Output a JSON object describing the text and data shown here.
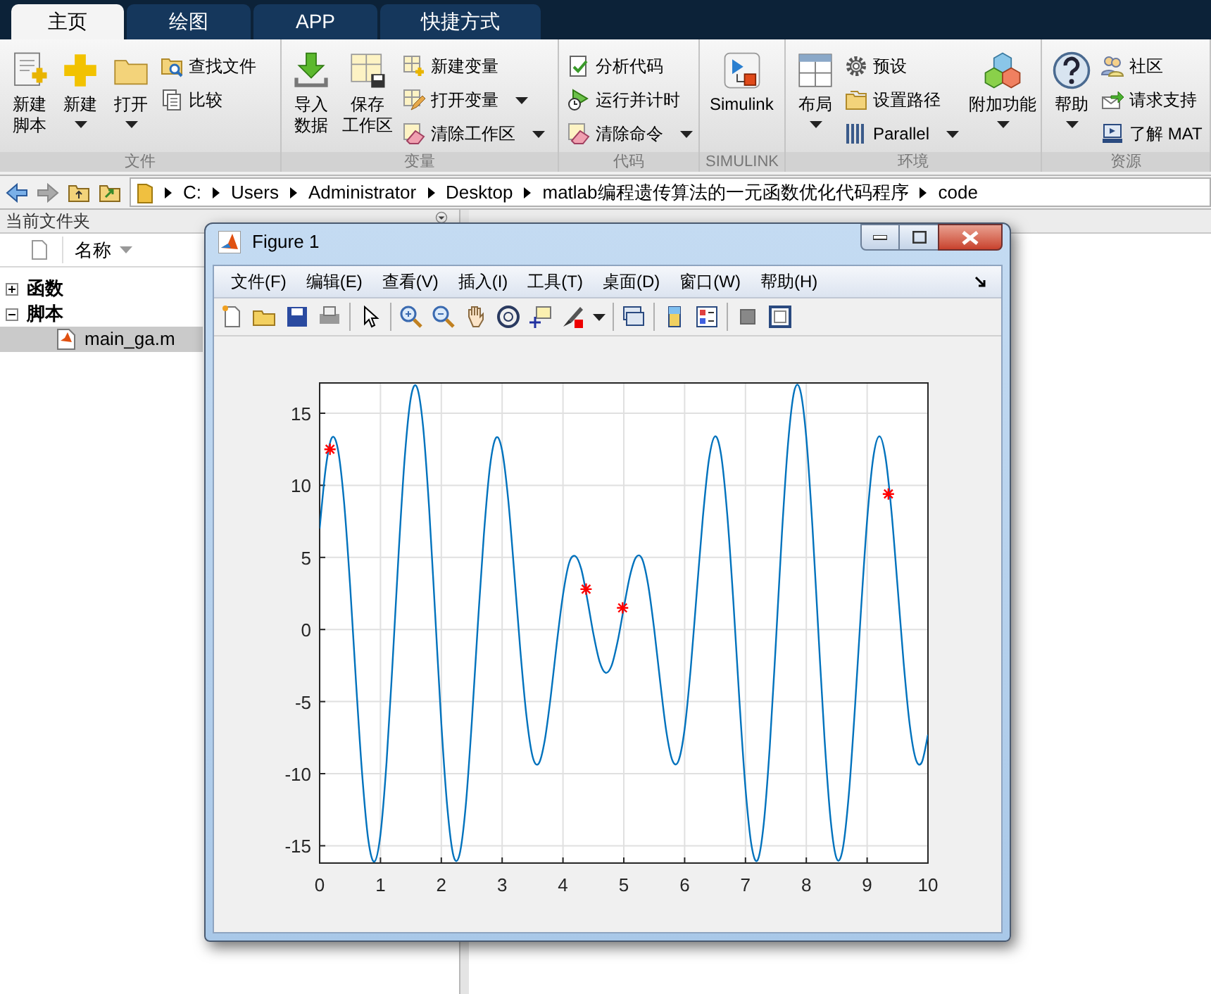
{
  "tabs": [
    {
      "label": "主页",
      "selected": true
    },
    {
      "label": "绘图",
      "selected": false
    },
    {
      "label": "APP",
      "selected": false
    },
    {
      "label": "快捷方式",
      "selected": false
    }
  ],
  "ribbon": {
    "groups": [
      {
        "label": "文件",
        "items": [
          {
            "kind": "large",
            "lines": [
              "新建",
              "脚本"
            ],
            "dropdown": false
          },
          {
            "kind": "large",
            "lines": [
              "新建"
            ],
            "dropdown": true
          },
          {
            "kind": "large",
            "lines": [
              "打开"
            ],
            "dropdown": true
          },
          {
            "kind": "small",
            "lines": [
              "查找文件"
            ],
            "dropdown": false
          },
          {
            "kind": "small",
            "lines": [
              "比较"
            ],
            "dropdown": false
          }
        ]
      },
      {
        "label": "变量",
        "items": [
          {
            "kind": "large",
            "lines": [
              "导入",
              "数据"
            ],
            "dropdown": false
          },
          {
            "kind": "large",
            "lines": [
              "保存",
              "工作区"
            ],
            "dropdown": false
          },
          {
            "kind": "small",
            "lines": [
              "新建变量"
            ],
            "dropdown": false
          },
          {
            "kind": "small",
            "lines": [
              "打开变量"
            ],
            "dropdown": true
          },
          {
            "kind": "small",
            "lines": [
              "清除工作区"
            ],
            "dropdown": true
          }
        ]
      },
      {
        "label": "代码",
        "items": [
          {
            "kind": "small",
            "lines": [
              "分析代码"
            ],
            "dropdown": false
          },
          {
            "kind": "small",
            "lines": [
              "运行并计时"
            ],
            "dropdown": false
          },
          {
            "kind": "small",
            "lines": [
              "清除命令"
            ],
            "dropdown": true
          }
        ]
      },
      {
        "label": "SIMULINK",
        "items": [
          {
            "kind": "large",
            "lines": [
              "Simulink"
            ],
            "dropdown": false
          }
        ]
      },
      {
        "label": "环境",
        "items": [
          {
            "kind": "large",
            "lines": [
              "布局"
            ],
            "dropdown": true
          },
          {
            "kind": "small",
            "lines": [
              "预设"
            ],
            "dropdown": false
          },
          {
            "kind": "small",
            "lines": [
              "设置路径"
            ],
            "dropdown": false
          },
          {
            "kind": "small",
            "lines": [
              "Parallel"
            ],
            "dropdown": true
          },
          {
            "kind": "large",
            "lines": [
              "附加功能"
            ],
            "dropdown": true
          }
        ]
      },
      {
        "label": "资源",
        "items": [
          {
            "kind": "large",
            "lines": [
              "帮助"
            ],
            "dropdown": true
          },
          {
            "kind": "small",
            "lines": [
              "社区"
            ],
            "dropdown": false
          },
          {
            "kind": "small",
            "lines": [
              "请求支持"
            ],
            "dropdown": false
          },
          {
            "kind": "small",
            "lines": [
              "了解 MAT"
            ],
            "dropdown": false
          }
        ]
      }
    ]
  },
  "path": [
    "C:",
    "Users",
    "Administrator",
    "Desktop",
    "matlab编程遗传算法的一元函数优化代码程序",
    "code"
  ],
  "current_folder": {
    "title": "当前文件夹",
    "column": "名称",
    "tree": [
      {
        "label": "函数",
        "expanded": false,
        "selected": false
      },
      {
        "label": "脚本",
        "expanded": true,
        "selected": false,
        "children": [
          {
            "label": "main_ga.m",
            "selected": true
          }
        ]
      }
    ]
  },
  "figure": {
    "title": "Figure 1",
    "menu": [
      "文件(F)",
      "编辑(E)",
      "查看(V)",
      "插入(I)",
      "工具(T)",
      "桌面(D)",
      "窗口(W)",
      "帮助(H)"
    ],
    "chart_data": {
      "type": "line",
      "grid": true,
      "xlim": [
        0,
        10
      ],
      "ylim": [
        -16.2,
        17.1
      ],
      "xticks": [
        0,
        1,
        2,
        3,
        4,
        5,
        6,
        7,
        8,
        9,
        10
      ],
      "yticks": [
        -15,
        -10,
        -5,
        0,
        5,
        10,
        15
      ],
      "x": [
        0,
        0.1,
        0.2,
        0.3,
        0.4,
        0.5,
        0.6,
        0.7,
        0.8,
        0.9,
        1,
        1.1,
        1.2,
        1.3,
        1.4,
        1.5,
        1.6,
        1.7,
        1.8,
        1.9,
        2,
        2.1,
        2.2,
        2.3,
        2.4,
        2.5,
        2.6,
        2.7,
        2.8,
        2.9,
        3,
        3.1,
        3.2,
        3.3,
        3.4,
        3.5,
        3.6,
        3.7,
        3.8,
        3.9,
        4,
        4.1,
        4.2,
        4.3,
        4.4,
        4.5,
        4.6,
        4.7,
        4.8,
        4.9,
        5,
        5.1,
        5.2,
        5.3,
        5.4,
        5.5,
        5.6,
        5.7,
        5.8,
        5.9,
        6,
        6.1,
        6.2,
        6.3,
        6.4,
        6.5,
        6.6,
        6.7,
        6.8,
        6.9,
        7,
        7.1,
        7.2,
        7.3,
        7.4,
        7.5,
        7.6,
        7.7,
        7.8,
        7.9,
        8,
        8.1,
        8.2,
        8.3,
        8.4,
        8.5,
        8.6,
        8.7,
        8.8,
        8.9,
        9,
        9.1,
        9.2,
        9.3,
        9.4,
        9.5,
        9.6,
        9.7,
        9.8,
        9.9,
        10
      ],
      "series": [
        {
          "type": "line",
          "color": "#0072bd",
          "values": [
            7.0,
            11.2,
            13.3,
            12.5,
            8.9,
            3.1,
            -3.8,
            -10.1,
            -14.6,
            -16.1,
            -14.2,
            -9.2,
            -2.2,
            5.4,
            12.0,
            16.1,
            16.8,
            14.1,
            8.4,
            1.0,
            -6.5,
            -12.4,
            -15.7,
            -15.6,
            -12.3,
            -6.5,
            0.3,
            6.6,
            11.3,
            13.3,
            12.4,
            9.0,
            3.9,
            -1.5,
            -6.0,
            -8.8,
            -9.3,
            -7.7,
            -4.6,
            -0.9,
            2.4,
            4.6,
            5.1,
            4.2,
            2.1,
            -0.3,
            -2.2,
            -3.0,
            -2.5,
            -0.8,
            1.5,
            3.7,
            5.0,
            4.9,
            3.1,
            0.0,
            -3.7,
            -7.1,
            -9.1,
            -9.1,
            -6.9,
            -2.7,
            2.6,
            7.8,
            11.8,
            13.4,
            12.1,
            8.0,
            2.0,
            -4.9,
            -11.0,
            -15.0,
            -16.0,
            -13.5,
            -8.1,
            -0.9,
            6.7,
            12.9,
            16.5,
            16.6,
            13.3,
            7.2,
            -0.3,
            -7.6,
            -13.2,
            -15.9,
            -15.2,
            -11.4,
            -5.4,
            1.4,
            7.6,
            11.9,
            13.4,
            12.0,
            8.2,
            3.0,
            -2.3,
            -6.6,
            -9.0,
            -9.2,
            -7.3
          ]
        },
        {
          "type": "scatter",
          "color": "#ff0000",
          "x": [
            0.17,
            4.38,
            4.98,
            9.35
          ],
          "values": [
            12.5,
            2.8,
            1.5,
            9.4
          ]
        }
      ]
    }
  }
}
